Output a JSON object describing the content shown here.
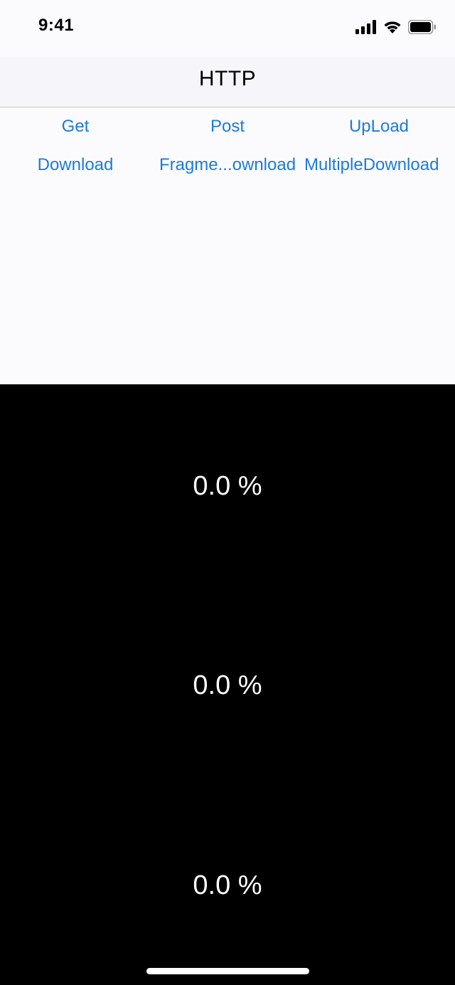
{
  "status_bar": {
    "time": "9:41",
    "icons": [
      "cellular-signal-icon",
      "wifi-icon",
      "battery-icon"
    ]
  },
  "nav": {
    "title": "HTTP"
  },
  "buttons": {
    "get": "Get",
    "post": "Post",
    "upload": "UpLoad",
    "download": "Download",
    "fragment_download": "Fragme...ownload",
    "multiple_download": "MultipleDownload"
  },
  "progress": [
    {
      "label": "0.0 %",
      "value": 0.0
    },
    {
      "label": "0.0 %",
      "value": 0.0
    },
    {
      "label": "0.0 %",
      "value": 0.0
    }
  ],
  "colors": {
    "accent": "#1b7bd9",
    "top_background": "#fbfbfe",
    "bottom_background": "#000000",
    "progress_text": "#ffffff"
  }
}
